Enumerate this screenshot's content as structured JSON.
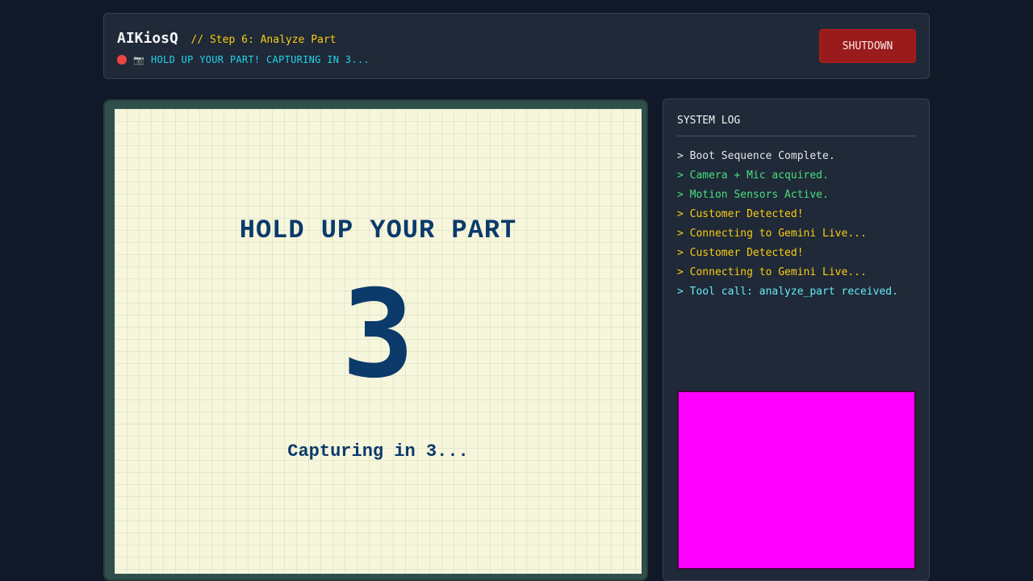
{
  "header": {
    "app_title": "AIKiosQ",
    "step_label": "// Step 6: Analyze Part",
    "camera_icon": "📷",
    "status_text": "HOLD UP YOUR PART! CAPTURING IN 3...",
    "shutdown_label": "SHUTDOWN"
  },
  "viewport": {
    "prompt_title": "HOLD UP YOUR PART",
    "countdown": "3",
    "capture_text": "Capturing in 3..."
  },
  "log": {
    "title": "SYSTEM LOG",
    "entries": [
      {
        "text": "> Boot Sequence Complete.",
        "color": "#e5e7eb"
      },
      {
        "text": "> Camera + Mic acquired.",
        "color": "#4ade80"
      },
      {
        "text": "> Motion Sensors Active.",
        "color": "#4ade80"
      },
      {
        "text": "> Customer Detected!",
        "color": "#facc15"
      },
      {
        "text": "> Connecting to Gemini Live...",
        "color": "#facc15"
      },
      {
        "text": "> Customer Detected!",
        "color": "#facc15"
      },
      {
        "text": "> Connecting to Gemini Live...",
        "color": "#facc15"
      },
      {
        "text": "> Tool call: analyze_part received.",
        "color": "#67e8f9"
      }
    ]
  },
  "colors": {
    "accent_yellow": "#facc15",
    "status_cyan": "#22d3ee",
    "danger_red": "#991b1b",
    "preview_magenta": "#ff00ff",
    "ink_blue": "#0b3a6b"
  }
}
